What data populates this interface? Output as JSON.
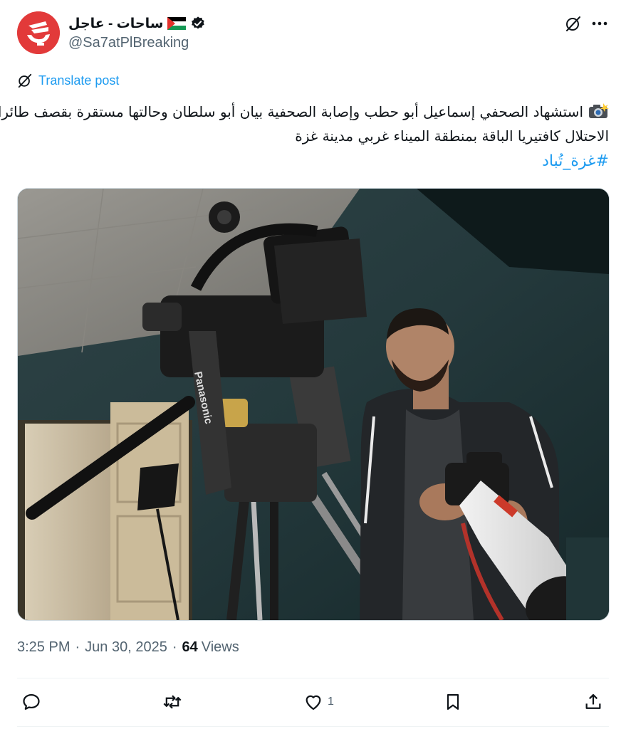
{
  "post": {
    "author": {
      "display_name": "ساحات - عاجل",
      "handle": "@Sa7atPlBreaking",
      "verified": true,
      "flag": "palestine-flag-emoji"
    },
    "translate_label": "Translate post",
    "text_lines": [
      "استشهاد الصحفي إسماعيل أبو حطب وإصابة الصحفية بيان أبو سلطان وحالتها مستقرة بقصف طائرات",
      "الاحتلال كافتيريا الباقة بمنطقة الميناء غربي مدينة غزة"
    ],
    "text_emoji": "camera-with-flash-emoji",
    "hashtag": "#غزة_تُباد",
    "media": {
      "brand_text": "Panasonic"
    },
    "time": "3:25 PM",
    "date": "Jun 30, 2025",
    "views_count": "64",
    "views_label": "Views",
    "separator": "·"
  },
  "actions": {
    "reply": {
      "icon": "reply-icon",
      "count": ""
    },
    "repost": {
      "icon": "repost-icon",
      "count": ""
    },
    "like": {
      "icon": "heart-icon",
      "count": "1"
    },
    "bookmark": {
      "icon": "bookmark-icon",
      "count": ""
    },
    "share": {
      "icon": "share-icon",
      "count": ""
    }
  },
  "colors": {
    "accent": "#1d9bf0",
    "text_primary": "#0f1419",
    "text_secondary": "#536471",
    "avatar_bg": "#e23a3a"
  }
}
